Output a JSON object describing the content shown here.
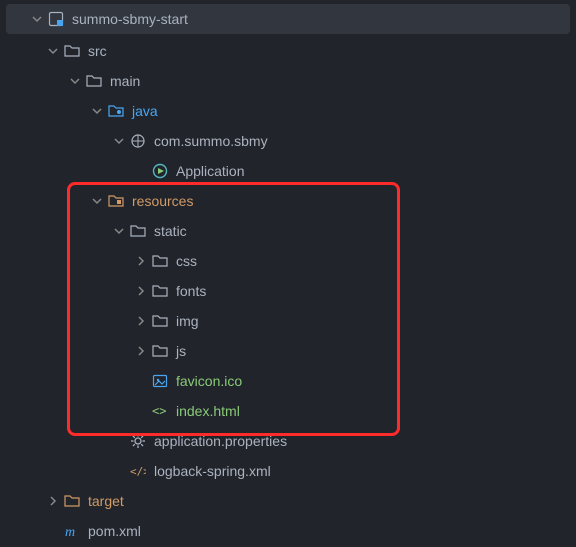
{
  "tree": {
    "root": "summo-sbmy-start",
    "src": "src",
    "main": "main",
    "java": "java",
    "pkg": "com.summo.sbmy",
    "app": "Application",
    "resources": "resources",
    "static": "static",
    "css": "css",
    "fonts": "fonts",
    "img": "img",
    "js": "js",
    "favicon": "favicon.ico",
    "index": "index.html",
    "appprops": "application.properties",
    "logback": "logback-spring.xml",
    "target": "target",
    "pom": "pom.xml"
  }
}
